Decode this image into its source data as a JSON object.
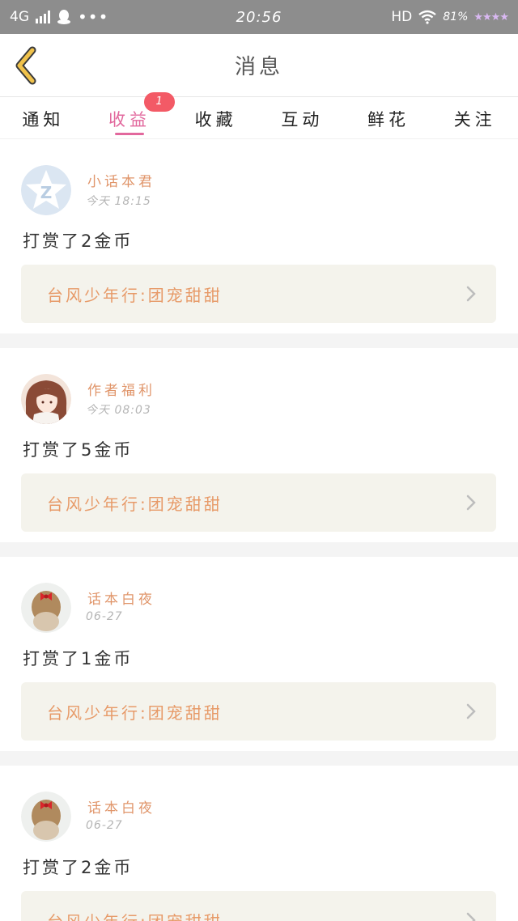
{
  "status_bar": {
    "network": "4G",
    "time": "20:56",
    "hd": "HD",
    "battery": "81%"
  },
  "header": {
    "title": "消息"
  },
  "tabs": [
    {
      "label": "通知",
      "active": false
    },
    {
      "label": "收益",
      "active": true,
      "badge": "1"
    },
    {
      "label": "收藏",
      "active": false
    },
    {
      "label": "互动",
      "active": false
    },
    {
      "label": "鲜花",
      "active": false
    },
    {
      "label": "关注",
      "active": false
    }
  ],
  "messages": [
    {
      "author": "小话本君",
      "time": "今天 18:15",
      "text": "打赏了2金币",
      "ref": "台风少年行:团宠甜甜",
      "avatar": "system-star-avatar"
    },
    {
      "author": "作者福利",
      "time": "今天 08:03",
      "text": "打赏了5金币",
      "ref": "台风少年行:团宠甜甜",
      "avatar": "anime-girl-avatar"
    },
    {
      "author": "话本白夜",
      "time": "06-27",
      "text": "打赏了1金币",
      "ref": "台风少年行:团宠甜甜",
      "avatar": "girl-bow-avatar"
    },
    {
      "author": "话本白夜",
      "time": "06-27",
      "text": "打赏了2金币",
      "ref": "台风少年行:团宠甜甜",
      "avatar": "girl-bow-avatar"
    }
  ],
  "colors": {
    "accent": "#e2689d",
    "badge": "#f35a66",
    "author": "#e0956a",
    "ref_text": "#e79a68",
    "ref_bg": "#f4f3ec",
    "back_arrow": "#f0c24b"
  }
}
